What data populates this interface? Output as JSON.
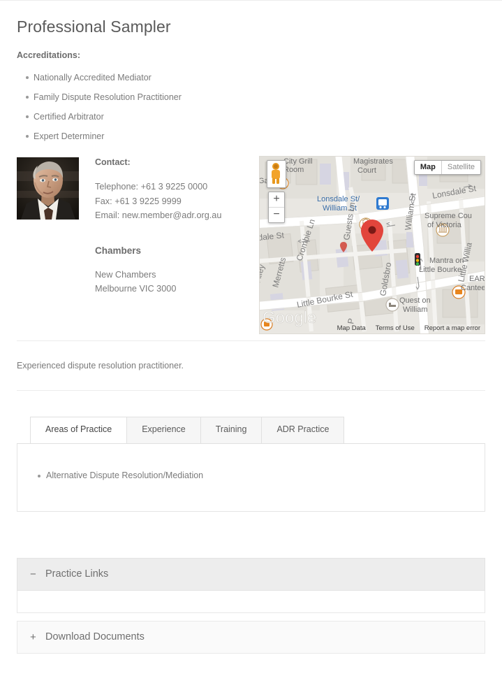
{
  "profile": {
    "name": "Professional Sampler",
    "accreditations_label": "Accreditations:",
    "accreditations": [
      "Nationally Accredited Mediator",
      "Family Dispute Resolution Practitioner",
      "Certified Arbitrator",
      "Expert Determiner"
    ],
    "description": "Experienced dispute resolution practitioner."
  },
  "contact": {
    "heading": "Contact:",
    "telephone": "Telephone: +61 3 9225 0000",
    "fax": "Fax: +61 3 9225 9999",
    "email": "Email: new.member@adr.org.au",
    "chambers_heading": "Chambers",
    "chambers_name": "New Chambers",
    "chambers_city": "Melbourne VIC 3000"
  },
  "map": {
    "type_map": "Map",
    "type_satellite": "Satellite",
    "zoom_in": "+",
    "zoom_out": "−",
    "attribution_logo": "Google",
    "footer": [
      "Map Data",
      "Terms of Use",
      "Report a map error"
    ],
    "labels": [
      "City Grill Room",
      "Magistrates Court",
      "Lonsdale St/ William St",
      "Lonsdale St",
      "Supreme Court of Victoria",
      "Guests Ln",
      "William St",
      "Crombie Ln",
      "Merretts",
      "Mann Alley",
      "Little Bourke St",
      "Goldsbro",
      "Quest on William",
      "Mantra on Little Bourke",
      "EAR Canteen",
      "Little William",
      "dale St",
      "Garr"
    ]
  },
  "tabs": {
    "items": [
      {
        "label": "Areas of Practice",
        "active": true
      },
      {
        "label": "Experience",
        "active": false
      },
      {
        "label": "Training",
        "active": false
      },
      {
        "label": "ADR Practice",
        "active": false
      }
    ],
    "panel_items": [
      "Alternative Dispute Resolution/Mediation"
    ]
  },
  "accordions": [
    {
      "title": "Practice Links",
      "sign": "−",
      "state": "open"
    },
    {
      "title": "Download Documents",
      "sign": "+",
      "state": "closed"
    }
  ],
  "colors": {
    "text": "#7b7b7b",
    "heading": "#5a5a5a",
    "rule": "#ececec",
    "marker": "#e2453c",
    "map_bg": "#e8e6e1"
  }
}
